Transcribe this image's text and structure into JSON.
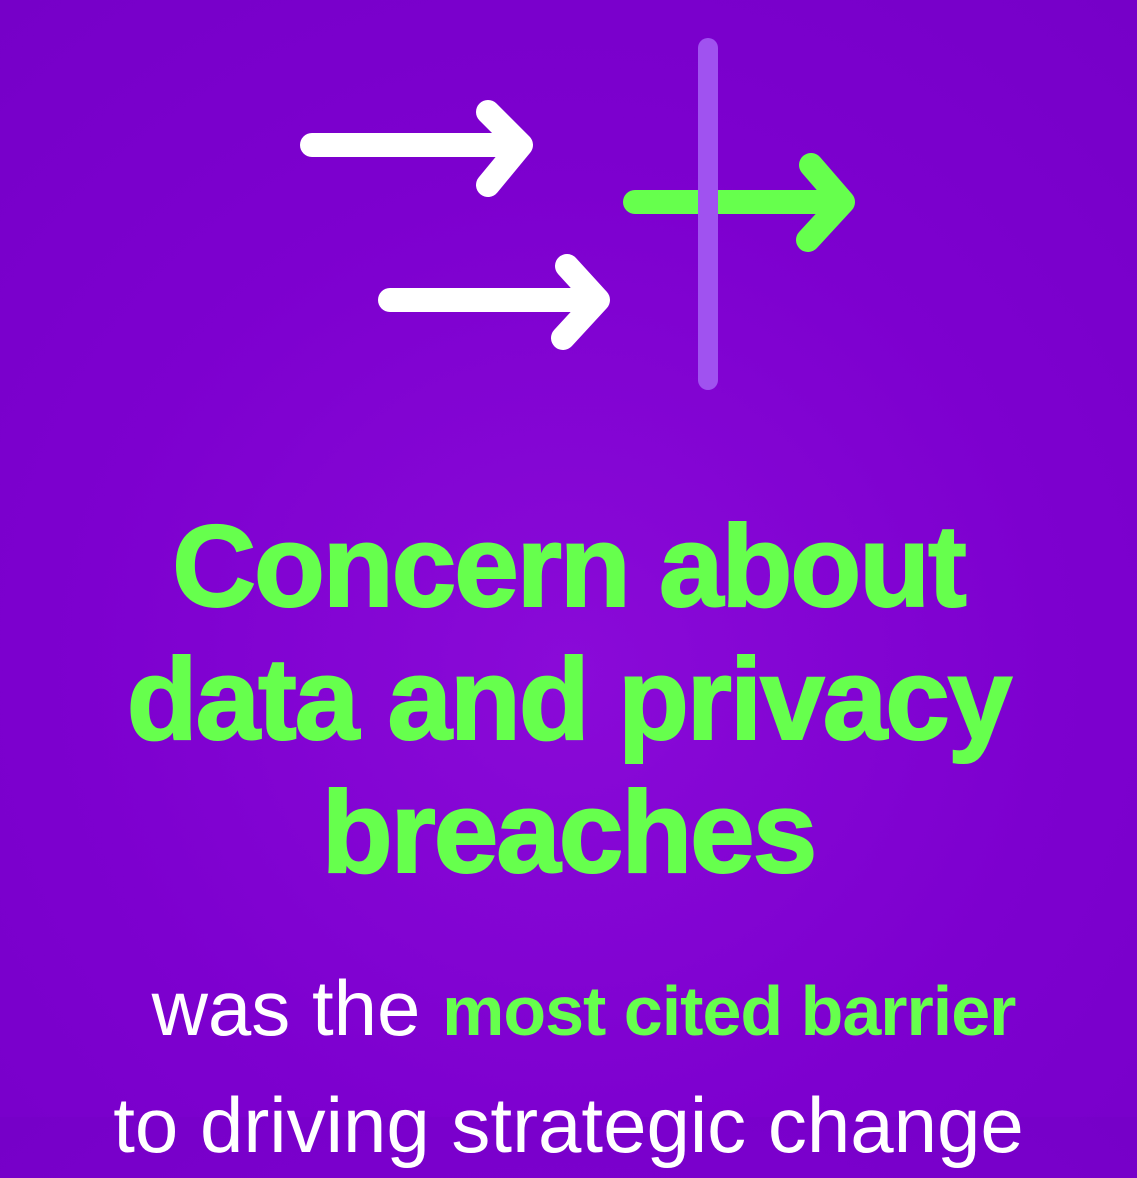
{
  "colors": {
    "background": "#7d00cf",
    "accent_green": "#66ff4d",
    "divider_purple": "#a052f0",
    "text_white": "#ffffff"
  },
  "icon": {
    "name": "arrows-crossing-line-icon"
  },
  "headline": {
    "line1": "Concern about",
    "line2": "data and privacy",
    "line3": "breaches"
  },
  "body": {
    "lead": "was the ",
    "highlight": "most cited barrier",
    "line2": "to driving strategic change"
  }
}
